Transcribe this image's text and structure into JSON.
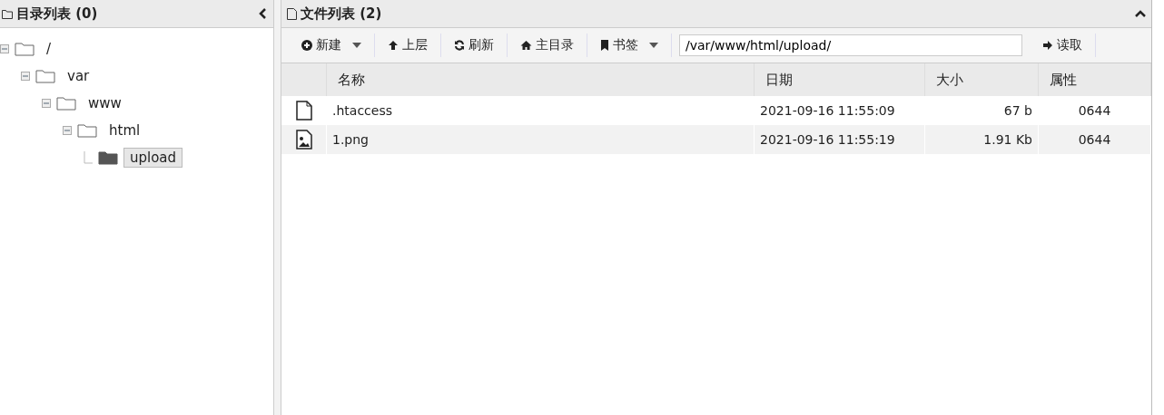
{
  "dir_panel": {
    "title": "目录列表 (0)",
    "tree": [
      {
        "label": "/",
        "expanded": true,
        "selected": false,
        "children": [
          {
            "label": "var",
            "expanded": true,
            "selected": false,
            "children": [
              {
                "label": "www",
                "expanded": true,
                "selected": false,
                "children": [
                  {
                    "label": "html",
                    "expanded": true,
                    "selected": false,
                    "children": [
                      {
                        "label": "upload",
                        "selected": true
                      }
                    ]
                  }
                ]
              }
            ]
          }
        ]
      }
    ]
  },
  "file_panel": {
    "title": "文件列表 (2)",
    "toolbar": [
      {
        "kind": "new",
        "label": "新建",
        "dropdown": true
      },
      {
        "kind": "up",
        "label": "上层",
        "dropdown": false
      },
      {
        "kind": "refresh",
        "label": "刷新",
        "dropdown": false
      },
      {
        "kind": "home",
        "label": "主目录",
        "dropdown": false
      },
      {
        "kind": "bookmark",
        "label": "书签",
        "dropdown": true
      }
    ],
    "path": "/var/www/html/upload/",
    "go_button": "读取",
    "columns": [
      "名称",
      "日期",
      "大小",
      "属性"
    ],
    "rows": [
      {
        "kind": "file",
        "name": ".htaccess",
        "date": "2021-09-16 11:55:09",
        "size": "67 b",
        "perm": "0644"
      },
      {
        "kind": "image",
        "name": "1.png",
        "date": "2021-09-16 11:55:19",
        "size": "1.91 Kb",
        "perm": "0644"
      }
    ]
  }
}
